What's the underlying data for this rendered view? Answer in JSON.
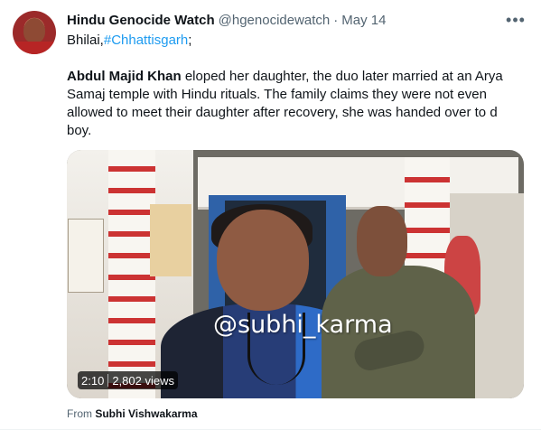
{
  "tweet": {
    "name": "Hindu Genocide Watch",
    "handle": "@hgenocidewatch",
    "separator": "·",
    "date": "May 14",
    "more_icon": "more-icon",
    "location_prefix": "Bhilai,",
    "hashtag": "#Chhattisgarh",
    "location_suffix": ";",
    "body_bold": "Abdul Majid Khan",
    "body_rest": " eloped her daughter, the duo later married at an Arya Samaj temple with Hindu rituals. The family claims they were not even allowed to meet their daughter after recovery, she was handed over to d boy."
  },
  "media": {
    "watermark": "@subhi_karma",
    "duration": "2:10",
    "views": "2,802 views"
  },
  "footer": {
    "from_label": "From",
    "from_name": "Subhi Vishwakarma"
  }
}
